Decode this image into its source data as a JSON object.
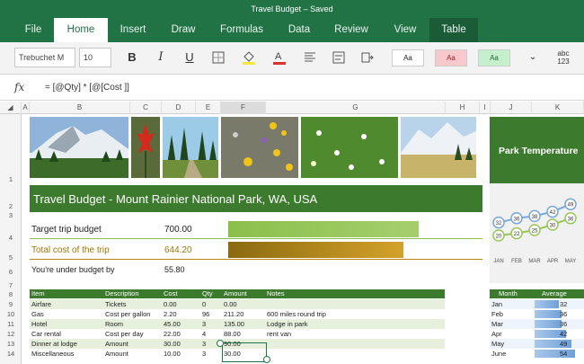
{
  "window": {
    "title": "Travel Budget – Saved"
  },
  "tabs": [
    "File",
    "Home",
    "Insert",
    "Draw",
    "Formulas",
    "Data",
    "Review",
    "View",
    "Table"
  ],
  "ribbon": {
    "font_name": "Trebuchet M",
    "font_size": "10",
    "style_normal": "Aa",
    "style_bad": "Aa",
    "style_good": "Aa",
    "number_format": "abc\n123"
  },
  "formula_bar": {
    "fx": "fx",
    "content": "= [@Qty] * [@[Cost ]]"
  },
  "columns": [
    "A",
    "B",
    "C",
    "D",
    "E",
    "F",
    "G",
    "H",
    "I",
    "J",
    "K"
  ],
  "rows": [
    "1",
    "2",
    "3",
    "4",
    "5",
    "6",
    "7",
    "8",
    "9",
    "10",
    "11",
    "12",
    "13",
    "14"
  ],
  "sheet": {
    "banner": "Travel Budget - Mount Rainier National Park, WA, USA",
    "target_label": "Target trip budget",
    "target_value": "700.00",
    "total_label": "Total cost of the trip",
    "total_value": "644.20",
    "under_label": "You're under budget by",
    "under_value": "55.80",
    "target_fraction": 1.0,
    "total_fraction": 0.92
  },
  "table": {
    "headers": [
      "Item",
      "Description",
      "Cost",
      "Qty",
      "Amount",
      "Notes"
    ],
    "rows": [
      [
        "Airfare",
        "Tickets",
        "0.00",
        "0",
        "0.00",
        ""
      ],
      [
        "Gas",
        "Cost per gallon",
        "2.20",
        "96",
        "211.20",
        "600 miles round trip"
      ],
      [
        "Hotel",
        "Room",
        "45.00",
        "3",
        "135.00",
        "Lodge in park"
      ],
      [
        "Car rental",
        "Cost per day",
        "22.00",
        "4",
        "88.00",
        "rent van"
      ],
      [
        "Dinner at lodge",
        "Amount",
        "30.00",
        "3",
        "90.00",
        ""
      ],
      [
        "Miscellaneous",
        "Amount",
        "10.00",
        "3",
        "30.00",
        ""
      ]
    ]
  },
  "chart": {
    "title": "Park Temperature",
    "months": [
      "JAN",
      "FEB",
      "MAR",
      "APR",
      "MAY"
    ],
    "series_high": [
      32,
      36,
      38,
      42,
      49
    ],
    "series_low": [
      20,
      22,
      25,
      30,
      36
    ]
  },
  "monthly": {
    "headers": [
      "Month",
      "Average"
    ],
    "rows": [
      [
        "Jan",
        "32"
      ],
      [
        "Feb",
        "36"
      ],
      [
        "Mar",
        "36"
      ],
      [
        "Apr",
        "42"
      ],
      [
        "May",
        "49"
      ],
      [
        "June",
        "54"
      ]
    ]
  },
  "colors": {
    "excel_green": "#217346",
    "banner_green": "#3c7a2e",
    "target_bar": "#8bbf4b",
    "total_bar": "#b8860b"
  }
}
